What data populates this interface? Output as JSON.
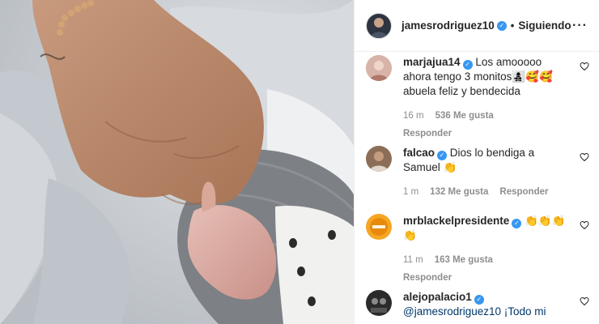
{
  "post": {
    "username": "jamesrodriguez10",
    "follow_status": "Siguiendo",
    "more_icon": "more-horizontal-icon"
  },
  "comments": [
    {
      "username": "marjajua14",
      "text": "Los amooooo ahora tengo 3 monitos👩‍👧‍👦🥰🥰 abuela feliz y bendecida",
      "time": "16 m",
      "likes": "536 Me gusta",
      "reply": "Responder"
    },
    {
      "username": "falcao",
      "text": "Dios lo bendiga a Samuel 👏",
      "time": "1 m",
      "likes": "132 Me gusta",
      "reply": "Responder"
    },
    {
      "username": "mrblackelpresidente",
      "text": "👏👏👏👏",
      "time": "11 m",
      "likes": "163 Me gusta",
      "reply": "Responder"
    },
    {
      "username": "alejopalacio1",
      "text": "@jamesrodriguez10 ¡Todo mi"
    }
  ],
  "colors": {
    "verified": "#3897f0",
    "meta": "#8e8e8e",
    "text": "#262626"
  }
}
